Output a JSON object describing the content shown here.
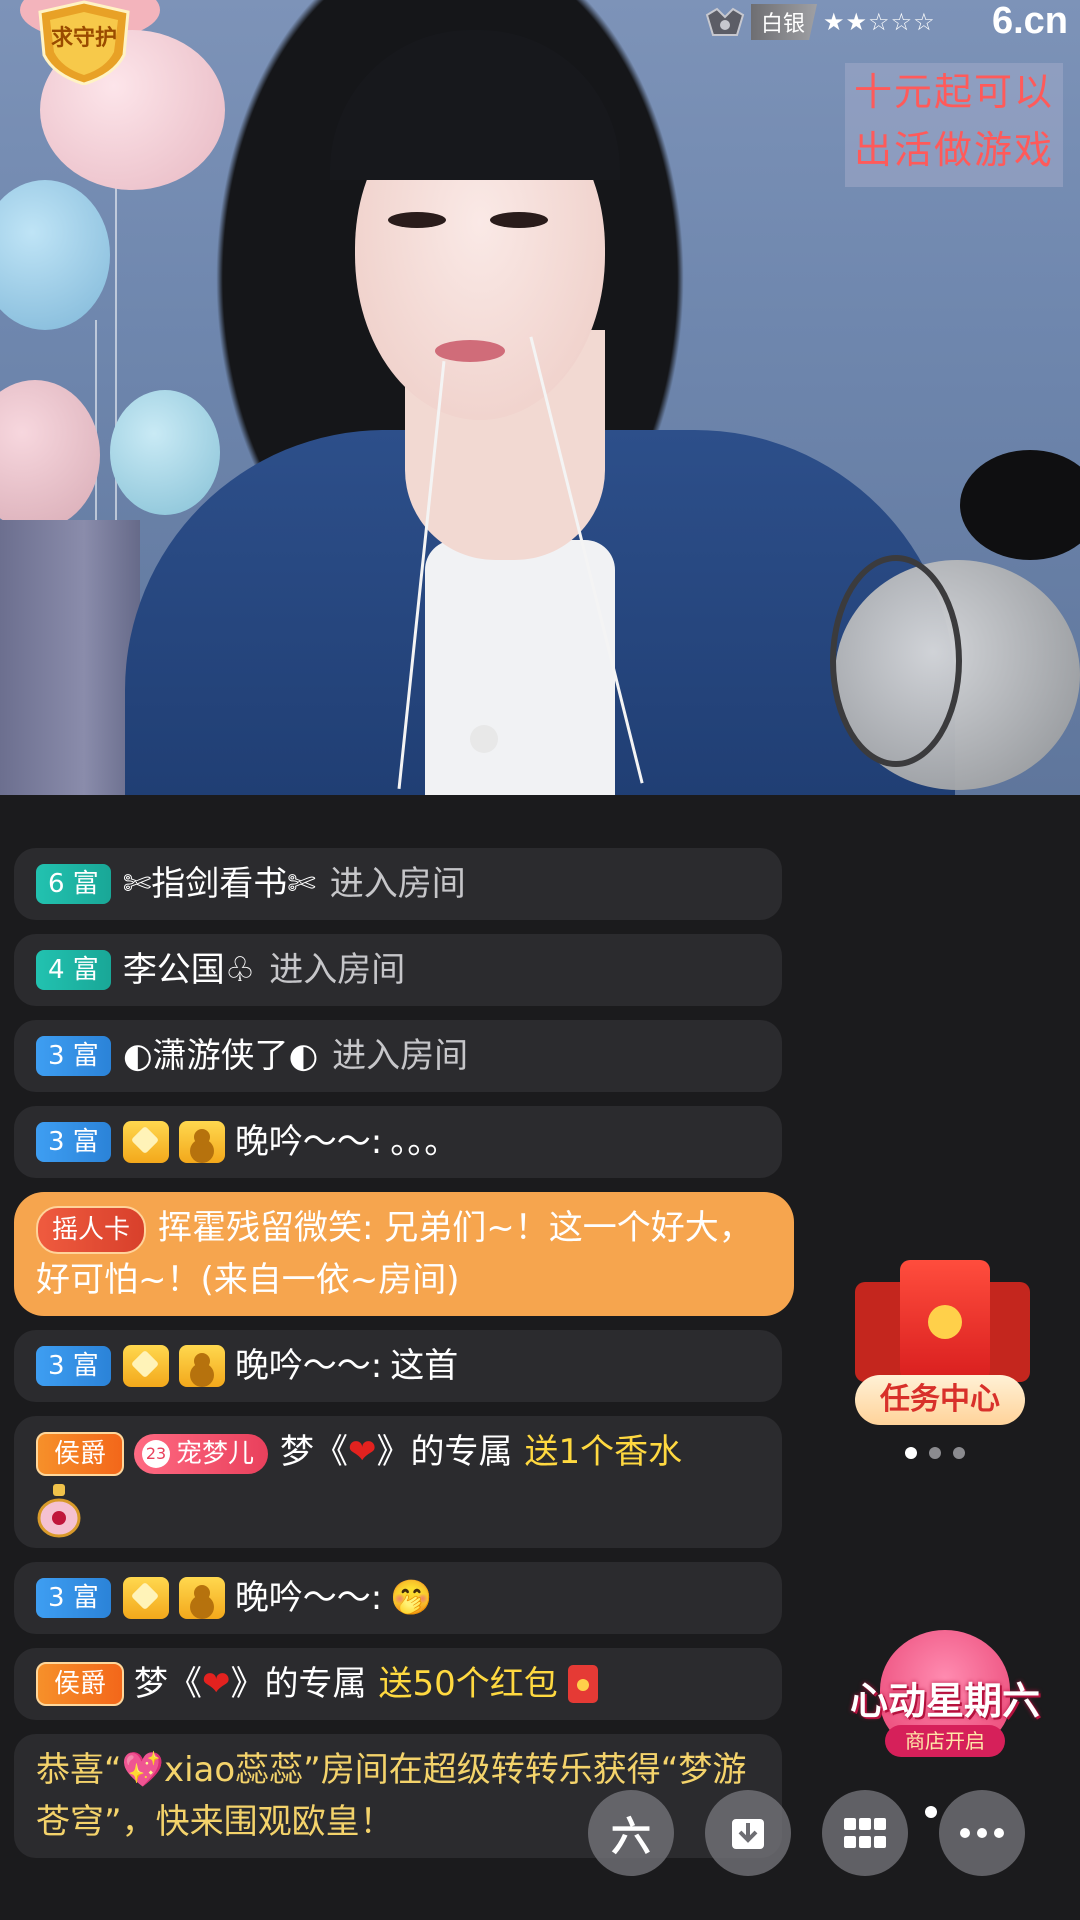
{
  "overlay": {
    "guard_badge": "求守护",
    "level_label": "白银",
    "stars": "★★☆☆☆",
    "site_logo": "6.cn",
    "promo_lines": [
      "十元起可以",
      "出活做游戏"
    ]
  },
  "chat": {
    "messages": [
      {
        "rich": "6 富",
        "name": "✄指剑看书✄",
        "action": "进入房间"
      },
      {
        "rich": "4 富",
        "name": "李公国♧",
        "action": "进入房间"
      },
      {
        "rich": "3 富",
        "name": "◐潇游侠了◐",
        "action": "进入房间"
      },
      {
        "rich": "3 富",
        "name": "晚吟〜〜:",
        "text": "。。。"
      },
      {
        "tag": "摇人卡",
        "text": "挥霍残留微笑: 兄弟们~！这一个好大，好可怕~！(来自一依~房间)"
      },
      {
        "rich": "3 富",
        "name": "晚吟〜〜:",
        "text": "这首"
      },
      {
        "tag": "侯爵",
        "pet_level": "23",
        "pet_name": "宠梦儿",
        "name": "梦《",
        "heart": "❤",
        "name_end": "》的专属",
        "gift": "送1个香水"
      },
      {
        "rich": "3 富",
        "name": "晚吟〜〜:",
        "text": "🤭"
      },
      {
        "tag": "侯爵",
        "name": "梦《",
        "heart": "❤",
        "name_end": "》的专属",
        "gift": "送50个红包"
      },
      {
        "text": "恭喜“💖xiao蕊蕊”房间在超级转转乐获得“梦游苍穹”，快来围观欧皇！"
      }
    ]
  },
  "widgets": {
    "task_center": "任务中心",
    "promo_title": "心动星期六",
    "promo_sub": "商店开启"
  },
  "toolbar": {
    "six_label": "六"
  }
}
